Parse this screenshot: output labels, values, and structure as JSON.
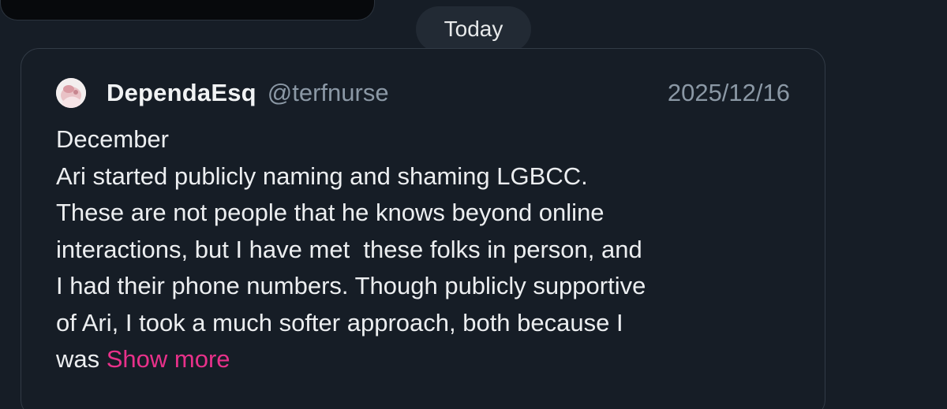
{
  "separator": {
    "date_label": "Today"
  },
  "post": {
    "avatar_icon": "user-avatar-icon",
    "display_name": "DependaEsq",
    "handle": "@terfnurse",
    "date": "2025/12/16",
    "lines": [
      "December",
      "Ari started publicly naming and shaming LGBCC.",
      "These are not people that he knows beyond online",
      "interactions, but I have met  these folks in person, and",
      "I had their phone numbers. Though publicly supportive",
      "of Ari, I took a much softer approach, both because I",
      "was "
    ],
    "show_more_label": "Show more",
    "show_more_color": "#e8318a"
  }
}
